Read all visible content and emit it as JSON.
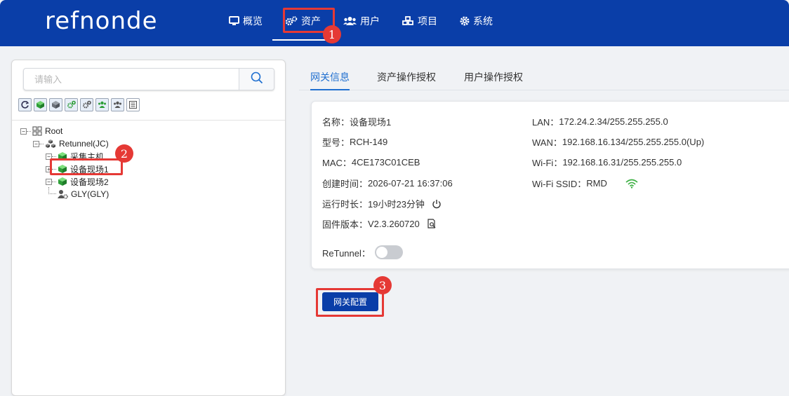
{
  "header": {
    "logo": "refnonde",
    "nav": [
      {
        "label": "概览",
        "icon": "monitor-icon"
      },
      {
        "label": "资产",
        "icon": "cogs-icon"
      },
      {
        "label": "用户",
        "icon": "users-icon"
      },
      {
        "label": "项目",
        "icon": "cubes-icon"
      },
      {
        "label": "系统",
        "icon": "gear-icon"
      }
    ],
    "active_nav": "资产"
  },
  "sidebar": {
    "search_placeholder": "请输入",
    "toolbar_icons": [
      "refresh-icon",
      "cube-green-icon",
      "cube-gray-icon",
      "cogs-green-icon",
      "cogs-gray-icon",
      "users-green-icon",
      "users-gray-icon",
      "list-icon"
    ],
    "tree": {
      "root": "Root",
      "gateway": "Retunnel(JC)",
      "children": [
        "采集主机",
        "设备现场1",
        "设备现场2",
        "GLY(GLY)"
      ],
      "selected": "设备现场1"
    }
  },
  "tabs": [
    "网关信息",
    "资产操作授权",
    "用户操作授权"
  ],
  "active_tab": "网关信息",
  "gateway_info": {
    "name_label": "名称：",
    "name": "设备现场1",
    "model_label": "型号：",
    "model": "RCH-149",
    "mac_label": "MAC：",
    "mac": "4CE173C01CEB",
    "created_label": "创建时间：",
    "created": "2026-07-21 16:37:06",
    "uptime_label": "运行时长：",
    "uptime": "19小时23分钟",
    "firmware_label": "固件版本：",
    "firmware": "V2.3.260720",
    "lan_label": "LAN：",
    "lan": "172.24.2.34/255.255.255.0",
    "wan_label": "WAN：",
    "wan": "192.168.16.134/255.255.255.0(Up)",
    "wifi_label": "Wi-Fi：",
    "wifi": "192.168.16.31/255.255.255.0",
    "ssid_label": "Wi-Fi SSID：",
    "ssid": "RMD",
    "retunnel_label": "ReTunnel：",
    "retunnel_enabled": false
  },
  "config_button": "网关配置",
  "annotations": [
    "1",
    "2",
    "3"
  ],
  "colors": {
    "brand": "#0a3ea8",
    "accent": "#1f6fd0",
    "highlight": "#e53935",
    "green": "#3cb043"
  }
}
